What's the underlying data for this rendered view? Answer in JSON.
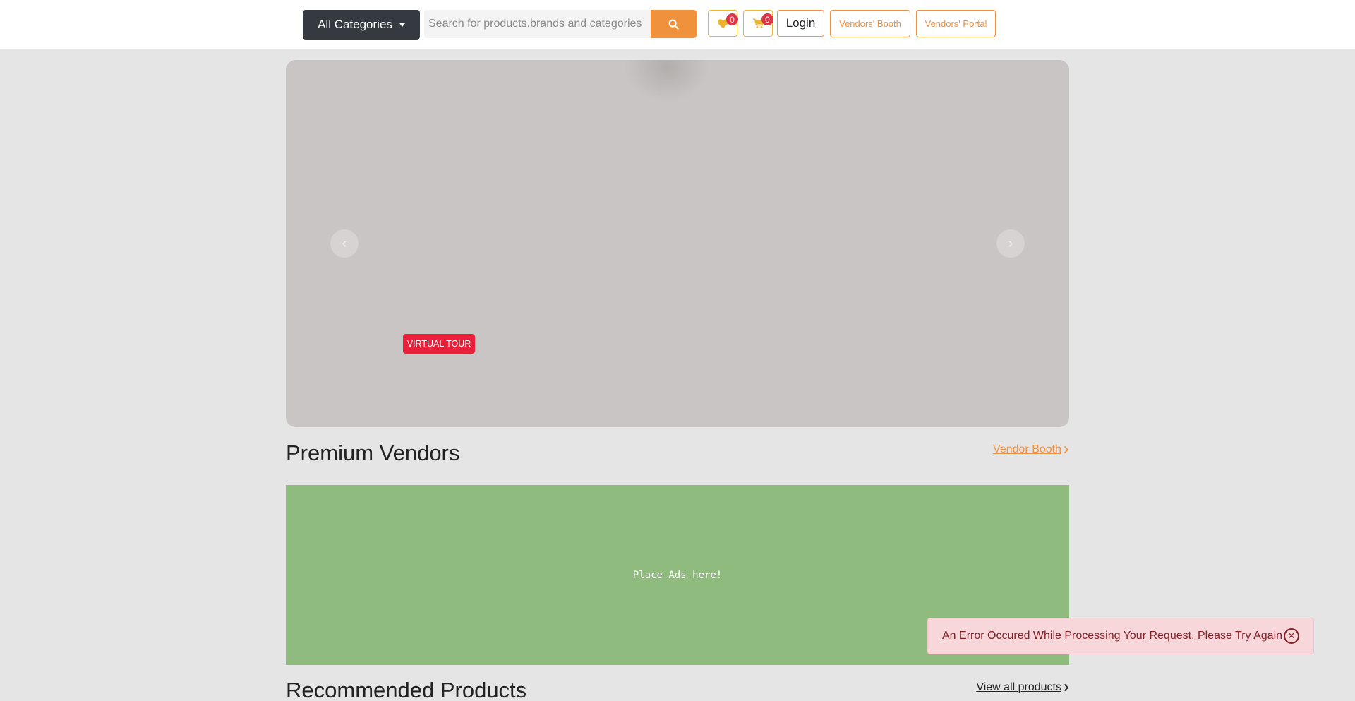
{
  "header": {
    "categories_label": "All Categories",
    "search": {
      "placeholder": "Search for products,brands and categories",
      "value": ""
    },
    "wishlist_count": "0",
    "cart_count": "0",
    "login_label": "Login",
    "vendors_booth_label": "Vendors' Booth",
    "vendors_portal_label": "Vendors' Portal"
  },
  "carousel": {
    "badge_label": "VIRTUAL TOUR",
    "prev_icon": "chevron-left-icon",
    "next_icon": "chevron-right-icon"
  },
  "premium_vendors": {
    "title": "Premium Vendors",
    "link_label": "Vendor Booth"
  },
  "ad": {
    "text": "Place Ads here!"
  },
  "recommended": {
    "title": "Recommended Products",
    "link_label": "View all products"
  },
  "toast": {
    "message": "An Error Occured While Processing Your Request. Please Try Again",
    "close_icon": "close-circle-icon"
  },
  "colors": {
    "accent": "#f0913c",
    "dark_button": "#343a40",
    "badge_red": "#dc3545",
    "virtual_tour_red": "#e8203a",
    "ad_green": "#8fbb7e",
    "toast_bg": "#f8d7da",
    "toast_text": "#842029"
  }
}
